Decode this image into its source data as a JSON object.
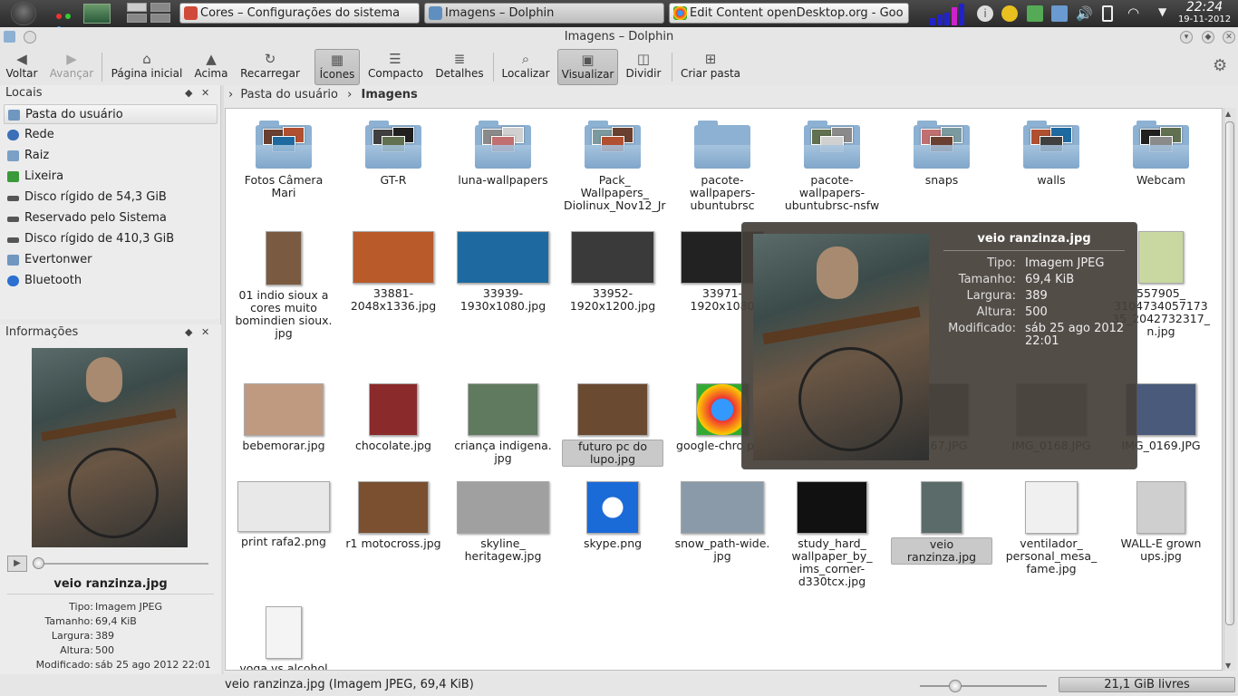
{
  "panel": {
    "tasks": [
      {
        "label": "Cores – Configurações do sistema",
        "icon_color": "#d04a3a"
      },
      {
        "label": "Imagens – Dolphin",
        "icon_color": "#5f8fbf"
      },
      {
        "label": "Edit  Content openDesktop.org - Goo",
        "icon_color": "#e3a21a"
      }
    ],
    "clock_time": "22:24",
    "clock_date": "19-11-2012"
  },
  "window": {
    "title": "Imagens – Dolphin"
  },
  "toolbar": {
    "back": "Voltar",
    "forward": "Avançar",
    "home": "Página inicial",
    "up": "Acima",
    "reload": "Recarregar",
    "icons": "Ícones",
    "compact": "Compacto",
    "details": "Detalhes",
    "find": "Localizar",
    "preview": "Visualizar",
    "split": "Dividir",
    "new_folder": "Criar pasta"
  },
  "places": {
    "title": "Locais",
    "items": [
      {
        "label": "Pasta do usuário",
        "icon_color": "#6f97c0"
      },
      {
        "label": "Rede",
        "icon_color": "#3b6fb8"
      },
      {
        "label": "Raiz",
        "icon_color": "#7aa0c6"
      },
      {
        "label": "Lixeira",
        "icon_color": "#3a9a3a"
      },
      {
        "label": "Disco rígido de 54,3 GiB",
        "icon_color": "#555555"
      },
      {
        "label": "Reservado pelo Sistema",
        "icon_color": "#555555"
      },
      {
        "label": "Disco rígido de 410,3 GiB",
        "icon_color": "#555555"
      },
      {
        "label": "Evertonwer",
        "icon_color": "#6f97c0"
      },
      {
        "label": "Bluetooth",
        "icon_color": "#2c6fd0"
      }
    ]
  },
  "info": {
    "title": "Informações",
    "filename": "veio ranzinza.jpg",
    "rows": [
      {
        "k": "Tipo:",
        "v": "Imagem JPEG"
      },
      {
        "k": "Tamanho:",
        "v": "69,4 KiB"
      },
      {
        "k": "Largura:",
        "v": "389"
      },
      {
        "k": "Altura:",
        "v": "500"
      },
      {
        "k": "Modificado:",
        "v": "sáb 25 ago 2012 22:01"
      }
    ]
  },
  "breadcrumb": {
    "root": "Pasta do usuário",
    "current": "Imagens"
  },
  "folders": [
    "Fotos Câmera Mari",
    "GT-R",
    "luna-wallpapers",
    "Pack_ Wallpapers_ Diolinux_Nov12_Jr",
    "pacote- wallpapers- ubuntubrsc",
    "pacote- wallpapers- ubuntubrsc-nsfw",
    "snaps",
    "walls",
    "Webcam"
  ],
  "files_row2": [
    "01 indio sioux a cores muito bomindien sioux. jpg",
    "33881- 2048x1336.jpg",
    "33939- 1930x1080.jpg",
    "33952- 1920x1200.jpg",
    "33971- 1920x1080",
    "557905_ 3104734057173 35_2042732317_ n.jpg"
  ],
  "files_row3": [
    "bebemorar.jpg",
    "chocolate.jpg",
    "criança indigena. jpg",
    "futuro pc do lupo.jpg",
    "google-chro png",
    "0167.JPG",
    "IMG_0168.JPG",
    "IMG_0169.JPG"
  ],
  "files_row4": [
    "print rafa2.png",
    "r1 motocross.jpg",
    "skyline_ heritagew.jpg",
    "skype.png",
    "snow_path-wide. jpg",
    "study_hard_ wallpaper_by_ ims_corner- d330tcx.jpg",
    "veio ranzinza.jpg",
    "ventilador_ personal_mesa_ fame.jpg",
    "WALL-E grown ups.jpg"
  ],
  "files_row5": [
    "yoga vs alcohol"
  ],
  "tooltip": {
    "title": "veio ranzinza.jpg",
    "rows": [
      {
        "k": "Tipo:",
        "v": "Imagem JPEG"
      },
      {
        "k": "Tamanho:",
        "v": "69,4 KiB"
      },
      {
        "k": "Largura:",
        "v": "389"
      },
      {
        "k": "Altura:",
        "v": "500"
      },
      {
        "k": "Modificado:",
        "v": "sáb 25 ago 2012 22:01"
      }
    ]
  },
  "status": {
    "text": "veio ranzinza.jpg (Imagem JPEG, 69,4 KiB)",
    "free": "21,1 GiB livres"
  }
}
